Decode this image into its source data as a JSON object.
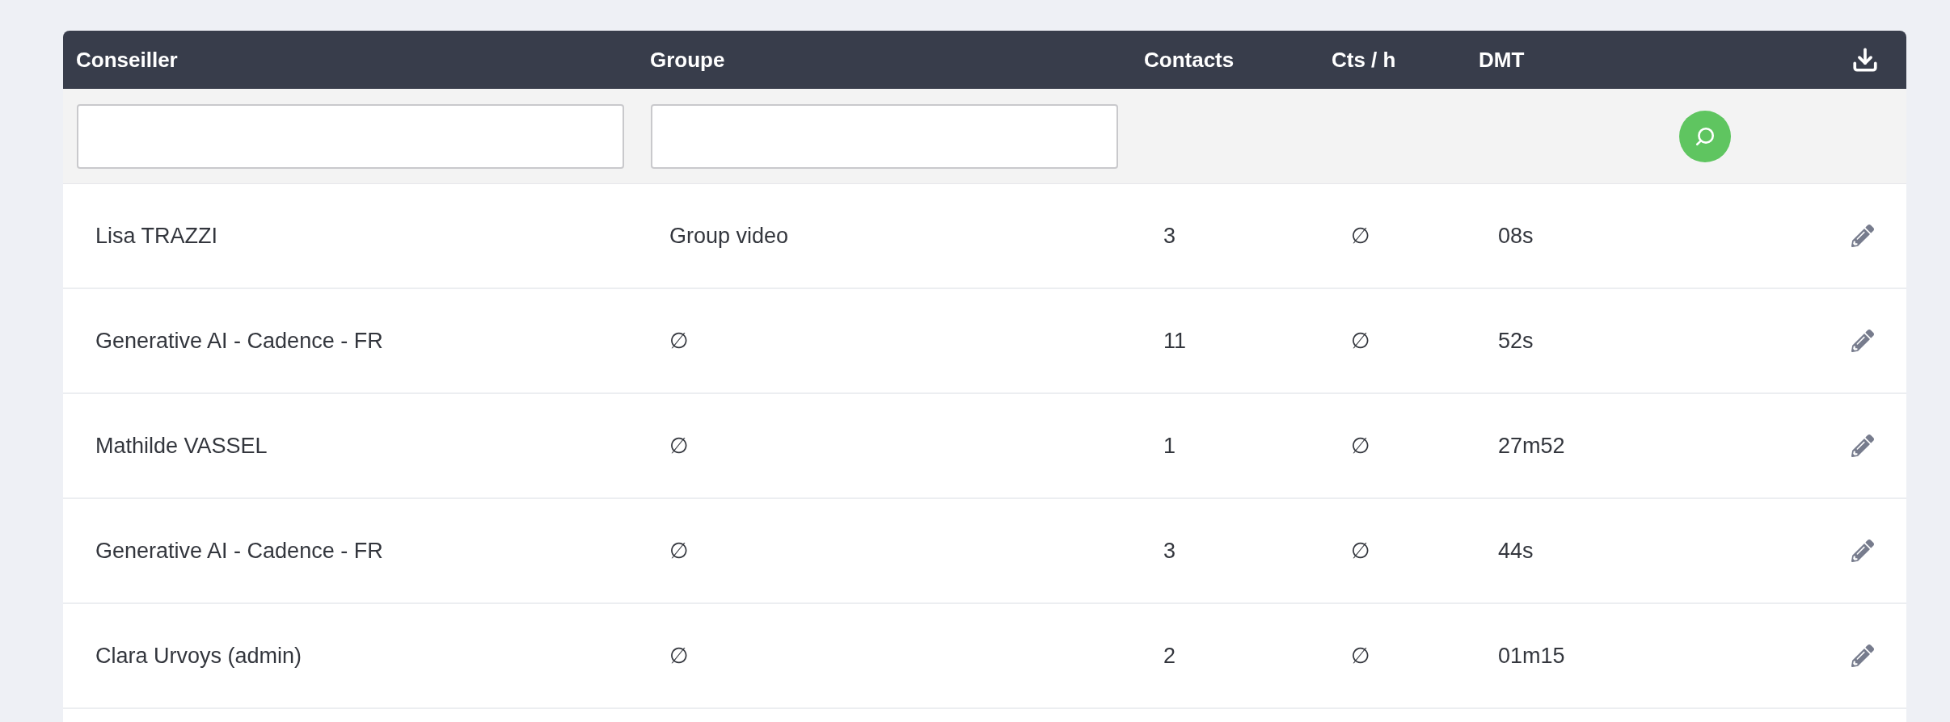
{
  "table": {
    "columns": [
      {
        "label": "Conseiller"
      },
      {
        "label": "Groupe"
      },
      {
        "label": "Contacts"
      },
      {
        "label": "Cts / h"
      },
      {
        "label": "DMT"
      }
    ],
    "filter_fields": [
      {
        "kind": "text"
      },
      {
        "kind": "text"
      }
    ],
    "rows": [
      {
        "conseiller": "Lisa TRAZZI",
        "groupe": "Group video",
        "contacts": "3",
        "cts_h": "∅",
        "dmt": "08s"
      },
      {
        "conseiller": "Generative AI - Cadence - FR",
        "groupe": "∅",
        "contacts": "11",
        "cts_h": "∅",
        "dmt": "52s"
      },
      {
        "conseiller": "Mathilde VASSEL",
        "groupe": "∅",
        "contacts": "1",
        "cts_h": "∅",
        "dmt": "27m52"
      },
      {
        "conseiller": "Generative AI - Cadence - FR",
        "groupe": "∅",
        "contacts": "3",
        "cts_h": "∅",
        "dmt": "44s"
      },
      {
        "conseiller": "Clara Urvoys (admin)",
        "groupe": "∅",
        "contacts": "2",
        "cts_h": "∅",
        "dmt": "01m15"
      }
    ]
  }
}
